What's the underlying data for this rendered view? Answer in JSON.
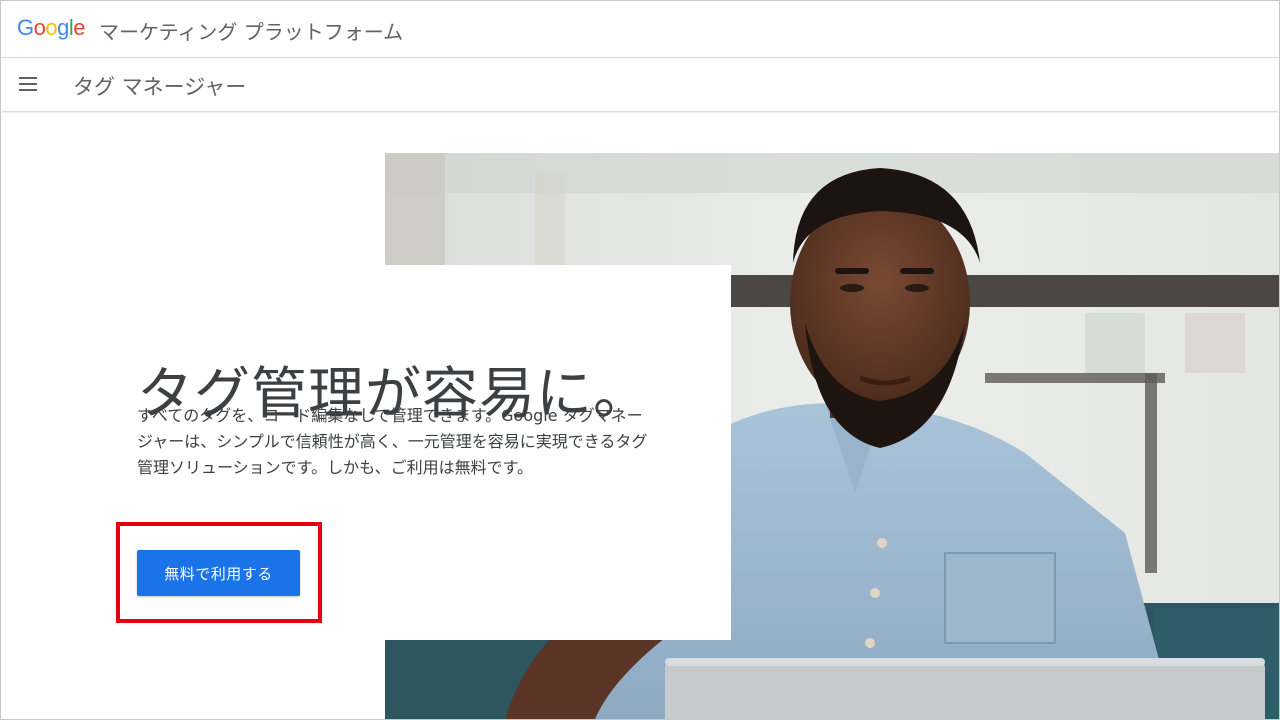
{
  "brand": {
    "logo_letters": [
      "G",
      "o",
      "o",
      "g",
      "l",
      "e"
    ],
    "logo_colors": [
      "#4285F4",
      "#EA4335",
      "#FBBC05",
      "#4285F4",
      "#34A853",
      "#EA4335"
    ],
    "platform_name": "マーケティング プラットフォーム"
  },
  "nav": {
    "menu_icon": "hamburger-menu-icon",
    "product_title": "タグ マネージャー"
  },
  "hero": {
    "headline": "タグ管理が容易に。",
    "description": "すべてのタグを、コード編集なしで管理できます。Google タグマネージャーは、シンプルで信頼性が高く、一元管理を容易に実現できるタグ管理ソリューションです。しかも、ご利用は無料です。",
    "cta_label": "無料で利用する",
    "cta_color": "#1a73e8",
    "highlight_color": "#e60012"
  }
}
